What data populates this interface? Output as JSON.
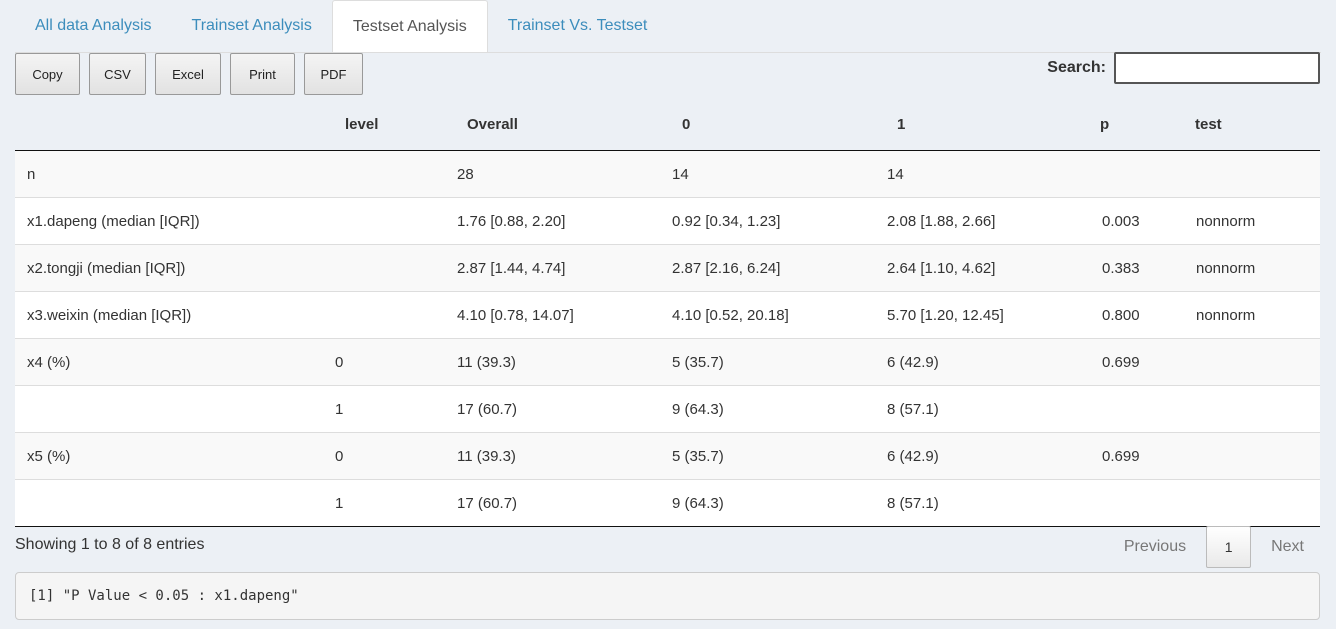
{
  "tabs": [
    {
      "label": "All data Analysis"
    },
    {
      "label": "Trainset Analysis"
    },
    {
      "label": "Testset Analysis"
    },
    {
      "label": "Trainset Vs. Testset"
    }
  ],
  "active_tab": "Testset Analysis",
  "buttons": {
    "copy": "Copy",
    "csv": "CSV",
    "excel": "Excel",
    "print": "Print",
    "pdf": "PDF"
  },
  "search": {
    "label": "Search:",
    "value": ""
  },
  "table": {
    "headers": [
      "",
      "level",
      "Overall",
      "0",
      "1",
      "p",
      "test"
    ],
    "rows": [
      [
        "n",
        "",
        "28",
        "14",
        "14",
        "",
        ""
      ],
      [
        "x1.dapeng (median [IQR])",
        "",
        "1.76 [0.88, 2.20]",
        "0.92 [0.34, 1.23]",
        "2.08 [1.88, 2.66]",
        "0.003",
        "nonnorm"
      ],
      [
        "x2.tongji (median [IQR])",
        "",
        "2.87 [1.44, 4.74]",
        "2.87 [2.16, 6.24]",
        "2.64 [1.10, 4.62]",
        "0.383",
        "nonnorm"
      ],
      [
        "x3.weixin (median [IQR])",
        "",
        "4.10 [0.78, 14.07]",
        "4.10 [0.52, 20.18]",
        "5.70 [1.20, 12.45]",
        "0.800",
        "nonnorm"
      ],
      [
        "x4 (%)",
        "0",
        "11 (39.3)",
        "5 (35.7)",
        "6 (42.9)",
        "0.699",
        ""
      ],
      [
        "",
        "1",
        "17 (60.7)",
        "9 (64.3)",
        "8 (57.1)",
        "",
        ""
      ],
      [
        "x5 (%)",
        "0",
        "11 (39.3)",
        "5 (35.7)",
        "6 (42.9)",
        "0.699",
        ""
      ],
      [
        "",
        "1",
        "17 (60.7)",
        "9 (64.3)",
        "8 (57.1)",
        "",
        ""
      ]
    ]
  },
  "info": "Showing 1 to 8 of 8 entries",
  "pagination": {
    "previous": "Previous",
    "current": "1",
    "next": "Next"
  },
  "output": "[1] \"P Value < 0.05 : x1.dapeng\""
}
